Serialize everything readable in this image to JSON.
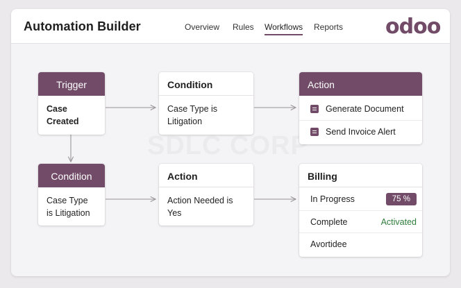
{
  "header": {
    "title": "Automation Builder",
    "nav": [
      "Overview",
      "Rules",
      "Workflows",
      "Reports"
    ],
    "active_nav": "Workflows",
    "logo": "odoo"
  },
  "watermark": "SDLC CORP",
  "colors": {
    "brand": "#714b67",
    "success": "#2e7d3a",
    "card_bg": "#ffffff"
  },
  "workflow": {
    "trigger": {
      "header": "Trigger",
      "body": [
        "Case",
        "Created"
      ]
    },
    "condition_top": {
      "header": "Condition",
      "body": [
        "Case Type is",
        "Litigation"
      ]
    },
    "action_top": {
      "header": "Action",
      "items": [
        {
          "label": "Generate Document",
          "icon": "document-icon"
        },
        {
          "label": "Send Invoice Alert",
          "icon": "alert-icon"
        }
      ]
    },
    "condition_bottom": {
      "header": "Condition",
      "body": [
        "Case Type",
        "is Litigation"
      ]
    },
    "action_bottom": {
      "header": "Action",
      "body": [
        "Action Needed is",
        "Yes"
      ]
    },
    "billing": {
      "header": "Billing",
      "rows": [
        {
          "label": "In Progress",
          "value": "75 %"
        },
        {
          "label": "Complete",
          "value": "Activated"
        },
        {
          "label": "Avortidee",
          "value": ""
        }
      ]
    }
  }
}
